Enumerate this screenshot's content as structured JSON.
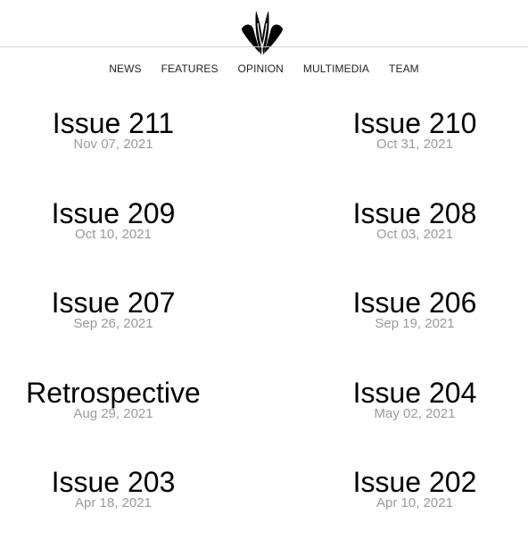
{
  "logo": {
    "icon": "tulip-logo-icon"
  },
  "nav": {
    "items": [
      {
        "label": "NEWS"
      },
      {
        "label": "FEATURES"
      },
      {
        "label": "OPINION"
      },
      {
        "label": "MULTIMEDIA"
      },
      {
        "label": "TEAM"
      }
    ]
  },
  "issues": [
    {
      "title": "Issue 211",
      "date": "Nov 07, 2021"
    },
    {
      "title": "Issue 210",
      "date": "Oct 31, 2021"
    },
    {
      "title": "Issue 209",
      "date": "Oct 10, 2021"
    },
    {
      "title": "Issue 208",
      "date": "Oct 03, 2021"
    },
    {
      "title": "Issue 207",
      "date": "Sep 26, 2021"
    },
    {
      "title": "Issue 206",
      "date": "Sep 19, 2021"
    },
    {
      "title": "Retrospective",
      "date": "Aug 29, 2021"
    },
    {
      "title": "Issue 204",
      "date": "May 02, 2021"
    },
    {
      "title": "Issue 203",
      "date": "Apr 18, 2021"
    },
    {
      "title": "Issue 202",
      "date": "Apr 10, 2021"
    }
  ],
  "colors": {
    "text": "#000000",
    "date": "#9a9a9a",
    "rule": "#cfcfcf",
    "background": "#ffffff"
  }
}
